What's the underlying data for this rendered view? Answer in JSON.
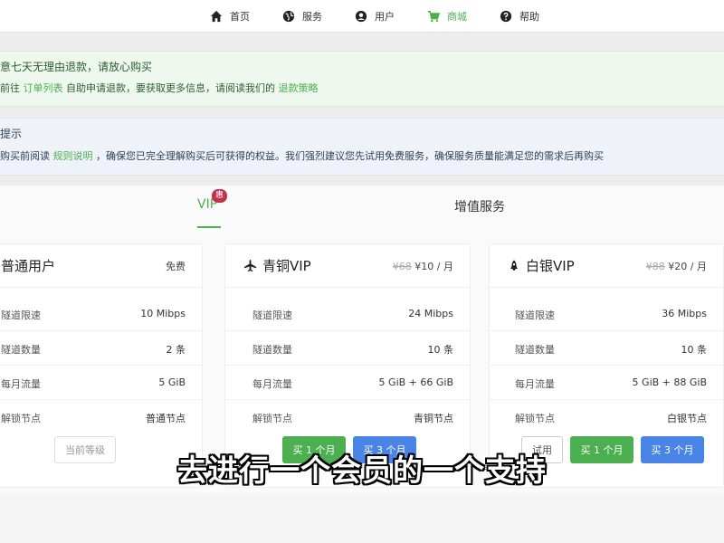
{
  "nav": {
    "items": [
      {
        "label": "首页",
        "icon": "home-icon"
      },
      {
        "label": "服务",
        "icon": "globe-icon"
      },
      {
        "label": "用户",
        "icon": "user-icon"
      },
      {
        "label": "商城",
        "icon": "cart-icon",
        "active": true
      },
      {
        "label": "帮助",
        "icon": "help-icon"
      }
    ]
  },
  "alert_refund": {
    "title": "意七天无理由退款，请放心购买",
    "text_a": "前往",
    "link_orders": "订单列表",
    "text_b": "自助申请退款，要获取更多信息，请阅读我们的",
    "link_policy": "退款策略"
  },
  "alert_notice": {
    "title": "提示",
    "text_a": "购买前阅读",
    "link_rules": "规则说明",
    "text_b": "，确保您已完全理解购买后可获得的权益。我们强烈建议您先试用免费服务，确保服务质量能满足您的需求后再购买"
  },
  "tabs": {
    "vip": "VIP",
    "vip_badge": "惠",
    "addon": "增值服务"
  },
  "plans": [
    {
      "name": "普通用户",
      "price": "免费",
      "rows": [
        {
          "k": "隧道限速",
          "v": "10 Mibps"
        },
        {
          "k": "隧道数量",
          "v": "2 条"
        },
        {
          "k": "每月流量",
          "v": "5 GiB"
        },
        {
          "k": "解锁节点",
          "v": "普通节点"
        }
      ],
      "button": "当前等级"
    },
    {
      "name": "青铜VIP",
      "icon": "plane-icon",
      "old_price": "¥68",
      "price": "¥10 / 月",
      "rows": [
        {
          "k": "隧道限速",
          "v": "24 Mibps"
        },
        {
          "k": "隧道数量",
          "v": "10 条"
        },
        {
          "k": "每月流量",
          "v": "5 GiB + 66 GiB"
        },
        {
          "k": "解锁节点",
          "v": "青铜节点"
        }
      ],
      "buttons": [
        "买 1 个月",
        "买 3 个月"
      ]
    },
    {
      "name": "白银VIP",
      "icon": "rocket-icon",
      "old_price": "¥88",
      "price": "¥20 / 月",
      "rows": [
        {
          "k": "隧道限速",
          "v": "36 Mibps"
        },
        {
          "k": "隧道数量",
          "v": "10 条"
        },
        {
          "k": "每月流量",
          "v": "5 GiB + 88 GiB"
        },
        {
          "k": "解锁节点",
          "v": "白银节点"
        }
      ],
      "buttons": [
        "试用",
        "买 1 个月",
        "买 3 个月"
      ]
    }
  ],
  "subtitle": "去进行一个会员的一个支持",
  "colors": {
    "accent_green": "#4caf50",
    "button_blue": "#4a84e6",
    "badge_red": "#c0334b"
  }
}
